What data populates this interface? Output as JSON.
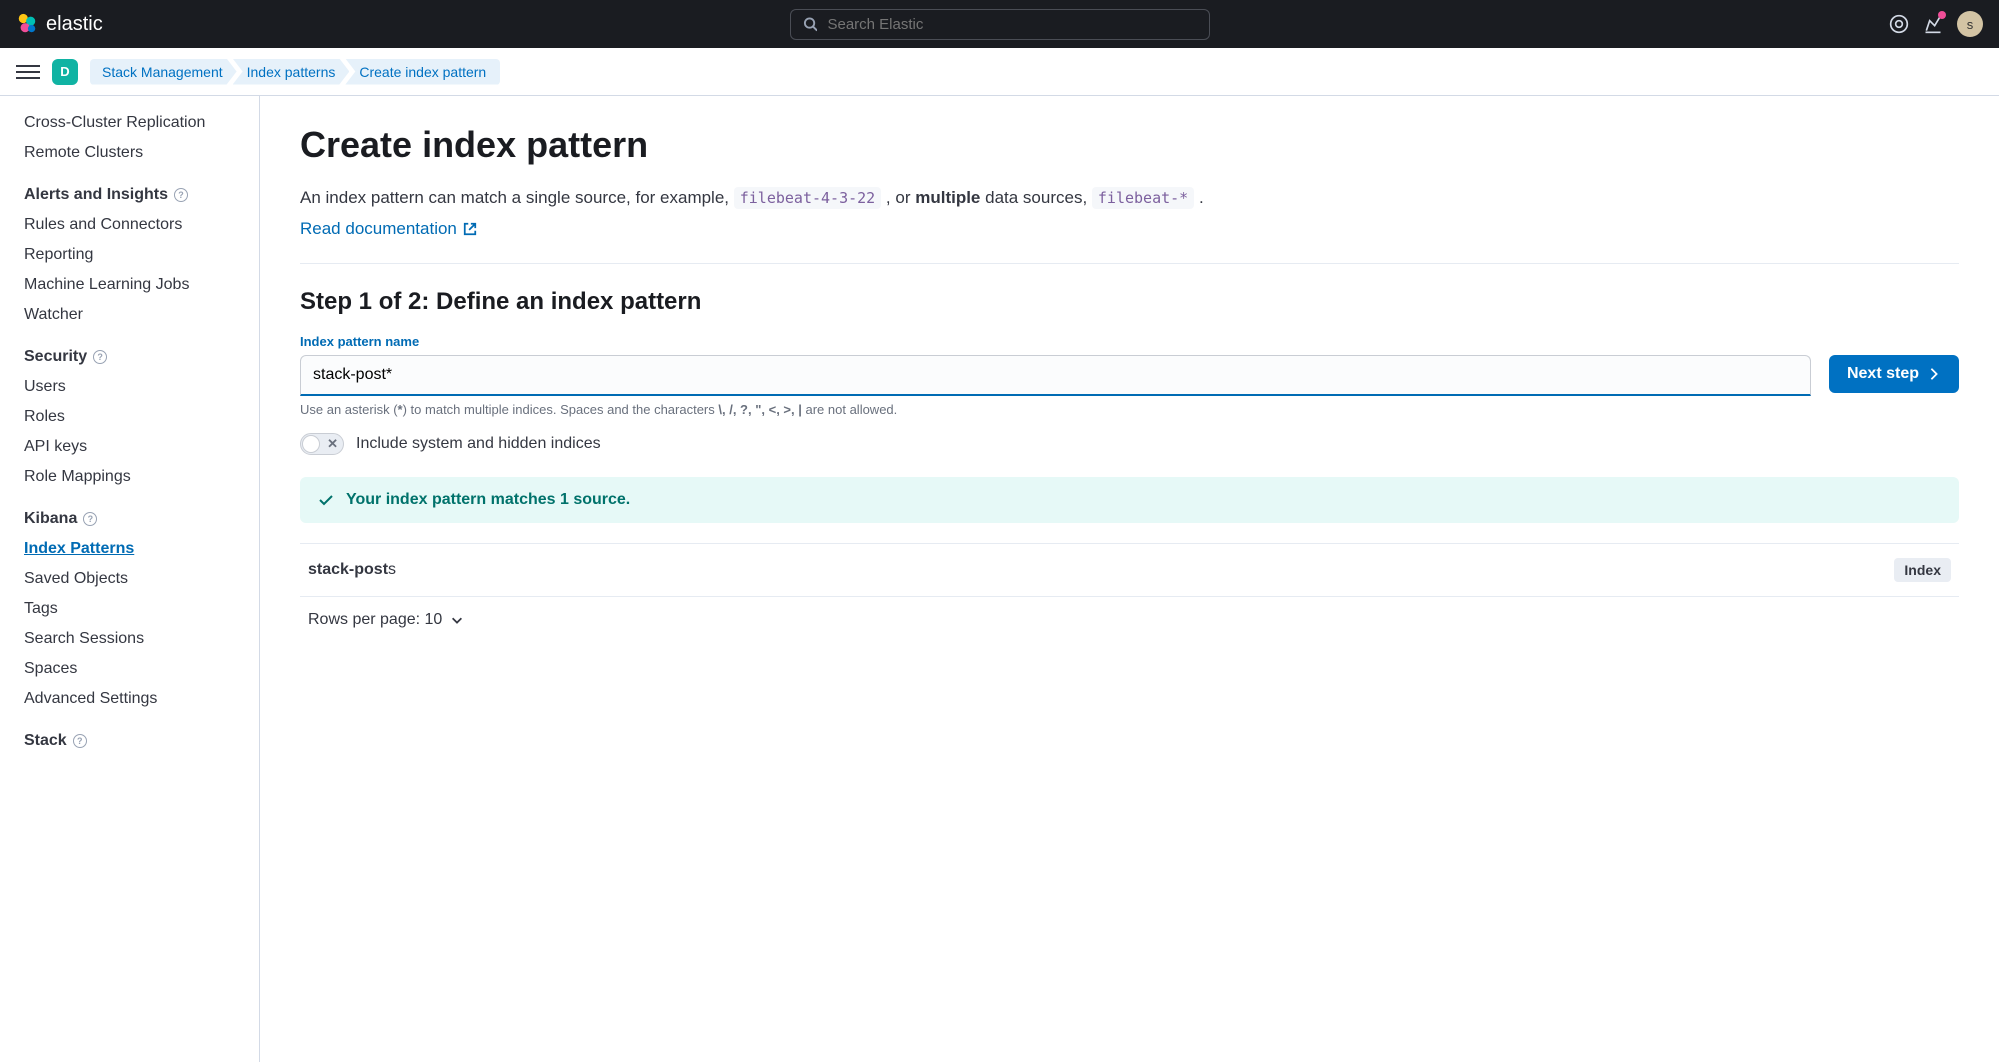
{
  "header": {
    "brand": "elastic",
    "search_placeholder": "Search Elastic",
    "space_letter": "D",
    "avatar_letter": "s"
  },
  "breadcrumbs": [
    "Stack Management",
    "Index patterns",
    "Create index pattern"
  ],
  "sidebar": {
    "top_items": [
      "Cross-Cluster Replication",
      "Remote Clusters"
    ],
    "sections": [
      {
        "title": "Alerts and Insights",
        "items": [
          "Rules and Connectors",
          "Reporting",
          "Machine Learning Jobs",
          "Watcher"
        ]
      },
      {
        "title": "Security",
        "items": [
          "Users",
          "Roles",
          "API keys",
          "Role Mappings"
        ]
      },
      {
        "title": "Kibana",
        "items": [
          "Index Patterns",
          "Saved Objects",
          "Tags",
          "Search Sessions",
          "Spaces",
          "Advanced Settings"
        ]
      },
      {
        "title": "Stack",
        "items": []
      }
    ],
    "active": "Index Patterns"
  },
  "page": {
    "title": "Create index pattern",
    "desc_pre": "An index pattern can match a single source, for example, ",
    "code1": "filebeat-4-3-22",
    "desc_mid": " , or ",
    "desc_bold": "multiple",
    "desc_after": " data sources, ",
    "code2": "filebeat-*",
    "desc_end": " .",
    "doc_link": "Read documentation",
    "step_title": "Step 1 of 2: Define an index pattern",
    "field_label": "Index pattern name",
    "input_value": "stack-post*",
    "next_button": "Next step",
    "help_pre": "Use an asterisk (",
    "help_ast": "*",
    "help_mid": ") to match multiple indices. Spaces and the characters ",
    "help_chars": "\\, /, ?, \", <, >, |",
    "help_end": " are not allowed.",
    "toggle_label": "Include system and hidden indices",
    "callout": "Your index pattern matches 1 source.",
    "match_bold": "stack-post",
    "match_rest": "s",
    "match_badge": "Index",
    "rows_per_page": "Rows per page: 10"
  }
}
